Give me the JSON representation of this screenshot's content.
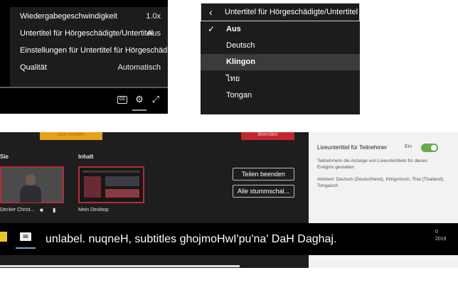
{
  "player_settings": {
    "items": [
      {
        "label": "Wiedergabegeschwindigkeit",
        "value": "1.0x"
      },
      {
        "label": "Untertitel für Hörgeschädigte/Untertitel",
        "value": "Aus"
      },
      {
        "label": "Einstellungen für Untertitel für Hörgeschädigte",
        "value": ""
      },
      {
        "label": "Qualität",
        "value": "Automatisch"
      }
    ],
    "icons": [
      "cc-icon",
      "gear-icon",
      "fullscreen-icon"
    ]
  },
  "subtitle_menu": {
    "title": "Untertitel für Hörgeschädigte/Untertitel",
    "options": [
      {
        "label": "Aus",
        "checked": true,
        "highlighted": false
      },
      {
        "label": "Deutsch",
        "checked": false,
        "highlighted": false
      },
      {
        "label": "Klingon",
        "checked": false,
        "highlighted": true
      },
      {
        "label": "ไทย",
        "checked": false,
        "highlighted": false
      },
      {
        "label": "Tongan",
        "checked": false,
        "highlighted": false
      }
    ]
  },
  "meeting": {
    "live_button": "Live senden",
    "end_button": "Beenden",
    "section_left": "Sie",
    "section_content": "Inhalt",
    "participant_name": "Decker Christ...",
    "desktop_label": "Mein Desktop",
    "stop_share_button": "Teilen beenden",
    "mute_all_button": "Alle stummschal...",
    "side_panel": {
      "title": "Liveuntertitel für Teilnehmer",
      "toggle_label": "Ein",
      "toggle_on": true,
      "description": "Teilnehmern die Anzeige von Liveuntertiteln für dieses Ereignis gestatten",
      "activated": "Aktiviert: Deutsch (Deutschland), Klingonisch, Thai (Thailand), Tongaisch"
    },
    "caption": "unlabel. nuqneH, subtitles ghojmoHwI'pu'na' DaH Daghaj.",
    "corner_text_1": "0",
    "corner_text_2": "2019"
  }
}
